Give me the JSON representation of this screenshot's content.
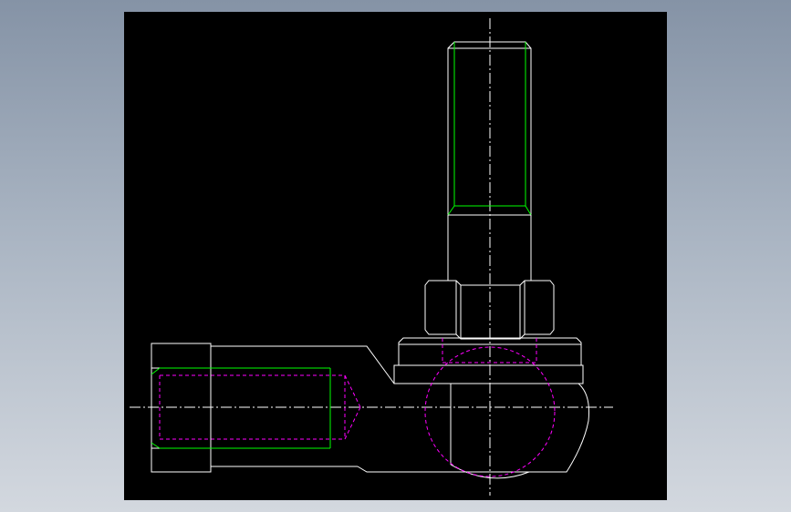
{
  "app": {
    "background_gradient": [
      "#8593a6",
      "#d3d8df"
    ],
    "viewport_background": "#000000"
  },
  "drawing": {
    "subject": "rod-end-ball-joint-assembly",
    "views": [
      "stud-thread-view",
      "hex-nut-view",
      "socket-housing-view",
      "shank-thread-view"
    ],
    "colors": {
      "outline": "#ffffff",
      "thread": "#00ff00",
      "hidden": "#ff00ff",
      "centerline": "#ffffff"
    },
    "line_styles": {
      "outline": "solid",
      "thread": "solid",
      "hidden": "dashed",
      "centerline": "dash-dot"
    }
  }
}
